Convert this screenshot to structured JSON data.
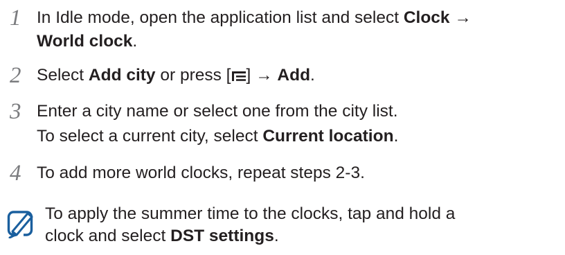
{
  "steps": [
    {
      "number": "1",
      "line1": {
        "pre": "In Idle mode, open the application list and select ",
        "b1": "Clock",
        "post": " →"
      },
      "line2": {
        "b1": "World clock",
        "post": "."
      }
    },
    {
      "number": "2",
      "line1": {
        "pre": "Select ",
        "b1": "Add city",
        "mid": " or press [",
        "icon": "menu-key-icon",
        "mid2": "] → ",
        "b2": "Add",
        "post": "."
      }
    },
    {
      "number": "3",
      "line1": {
        "pre": "Enter a city name or select one from the city list."
      },
      "line2": {
        "pre": "To select a current city, select ",
        "b1": "Current location",
        "post": "."
      }
    },
    {
      "number": "4",
      "line1": {
        "pre": "To add more world clocks, repeat steps 2-3."
      }
    }
  ],
  "note": {
    "icon": "note-pencil-icon",
    "line1": "To apply the summer time to the clocks, tap and hold a",
    "line2": {
      "pre": "clock and select ",
      "b1": "DST settings",
      "post": "."
    }
  },
  "colors": {
    "text": "#231f20",
    "step_number": "#7a7b7e",
    "note_icon": "#1a5f9e"
  }
}
